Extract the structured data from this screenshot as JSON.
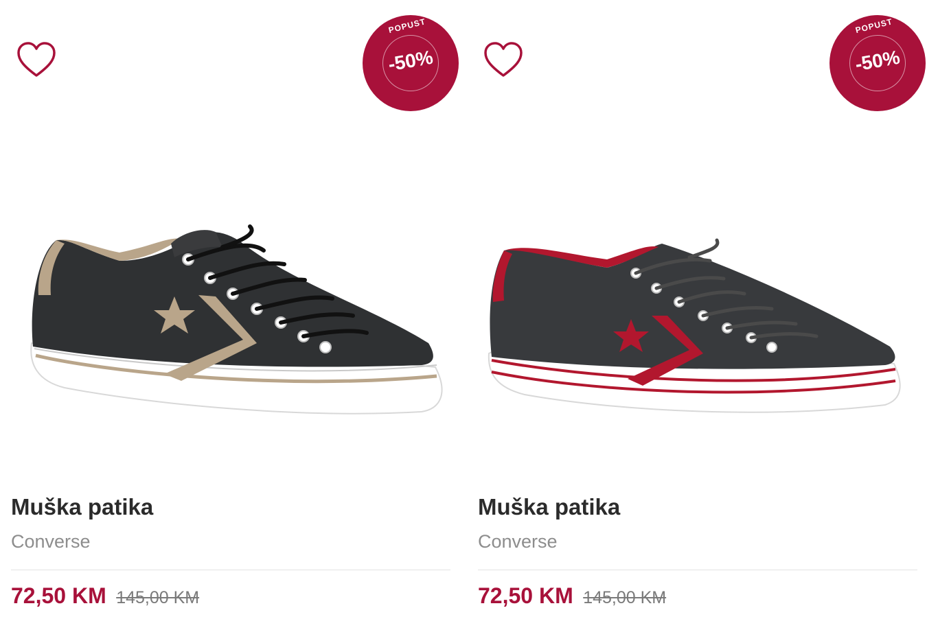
{
  "products": [
    {
      "wishlist_icon": "heart-outline-icon",
      "badge_top": "POPUST",
      "badge_discount": "-50%",
      "image": "black-leather-sneaker-beige-accents",
      "title": "Muška patika",
      "brand": "Converse",
      "price": "72,50 KM",
      "old_price": "145,00 KM",
      "accent_color": "#b9a58a"
    },
    {
      "wishlist_icon": "heart-outline-icon",
      "badge_top": "POPUST",
      "badge_discount": "-50%",
      "image": "black-leather-sneaker-red-accents",
      "title": "Muška patika",
      "brand": "Converse",
      "price": "72,50 KM",
      "old_price": "145,00 KM",
      "accent_color": "#b2172e"
    }
  ],
  "colors": {
    "badge": "#a8113a",
    "price": "#a8113a",
    "title": "#2b2b2b",
    "brand": "#8d8d8d"
  }
}
